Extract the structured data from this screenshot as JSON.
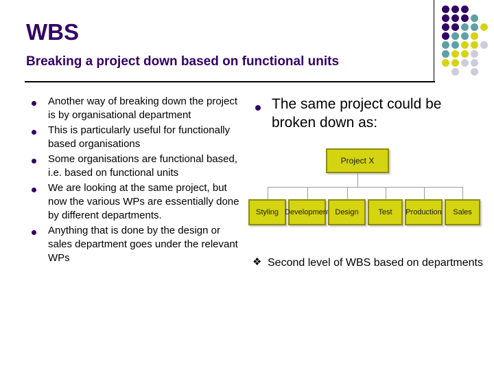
{
  "slide": {
    "title": "WBS",
    "subtitle": "Breaking a project down based on functional units"
  },
  "theme": {
    "title_color": "#330066",
    "accent_purple": "#330066",
    "accent_teal": "#5ea0a6",
    "accent_yellow": "#d4d411",
    "accent_lavender": "#ccccdd",
    "node_fill": "#d4d411",
    "node_border": "#8b8b09",
    "rule_color": "#000000"
  },
  "decor": {
    "dot_grid_name": "decorative-dot-grid",
    "colors": {
      "purple": "#330066",
      "teal": "#5ea0a6",
      "yellow": "#d4d411",
      "lavender": "#ccccdd"
    },
    "rows": [
      [
        "purple",
        "purple",
        "purple",
        null,
        null
      ],
      [
        "purple",
        "purple",
        "purple",
        "teal",
        null
      ],
      [
        "purple",
        "purple",
        "teal",
        "teal",
        "yellow"
      ],
      [
        "purple",
        "teal",
        "teal",
        "yellow",
        null
      ],
      [
        "teal",
        "teal",
        "yellow",
        "yellow",
        "lavender"
      ],
      [
        "teal",
        "yellow",
        "yellow",
        "lavender",
        null
      ],
      [
        "yellow",
        "yellow",
        "lavender",
        "lavender",
        null
      ],
      [
        null,
        "lavender",
        null,
        "lavender",
        null
      ]
    ]
  },
  "left_column": {
    "bullet_glyph": "●",
    "items": [
      "Another way of breaking down the project is by organisational department",
      "This is particularly useful for functionally based organisations",
      "Some organisations are functional based, i.e. based on functional units",
      "We are looking at the same project, but now the various WPs are essentially done by different departments.",
      "Anything that is done by the design or sales department goes under the relevant WPs"
    ]
  },
  "right_column": {
    "heading_bullet_glyph": "●",
    "heading": "The same project could be broken down as:",
    "footnote_bullet_glyph": "❖",
    "footnote": "Second level of WBS based on departments"
  },
  "org_chart": {
    "type": "diagram",
    "root": {
      "label": "Project X"
    },
    "children": [
      {
        "label": "Styling"
      },
      {
        "label": "Development"
      },
      {
        "label": "Design"
      },
      {
        "label": "Test"
      },
      {
        "label": "Production"
      },
      {
        "label": "Sales"
      }
    ]
  }
}
